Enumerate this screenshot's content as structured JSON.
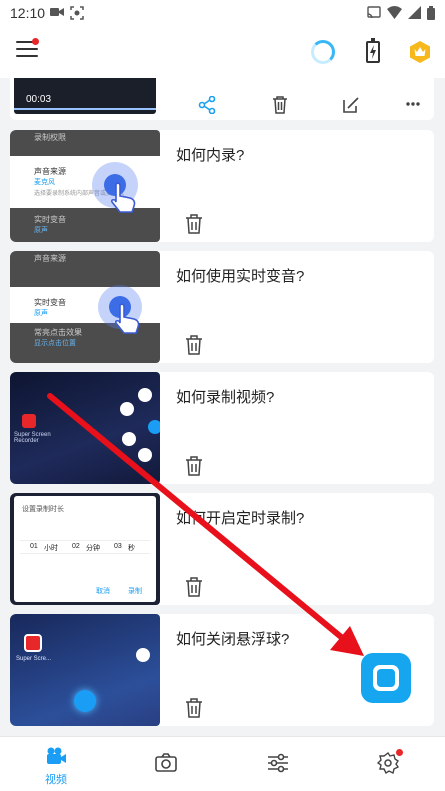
{
  "status_bar": {
    "time": "12:10"
  },
  "cards": [
    {
      "title": "如何内录?",
      "thumb": {
        "row1": "录制权限",
        "row2": "声音来源",
        "row2b": "麦克风",
        "row2c": "选择要录制系统内部声音或麦克风",
        "row3": "实时变音",
        "row3b": "原声"
      }
    },
    {
      "title": "如何使用实时变音?",
      "thumb": {
        "row1": "声音来源",
        "row2": "实时变音",
        "row2b": "原声",
        "row3": "常亮点击效果",
        "row3b": "显示点击位置"
      }
    },
    {
      "title": "如何录制视频?",
      "thumb": {
        "app_name": "Super Screen Recorder"
      }
    },
    {
      "title": "如何开启定时录制?",
      "thumb": {
        "dialog_title": "设置录制时长",
        "cols": [
          "小时",
          "分钟",
          "秒"
        ],
        "vals": [
          "01",
          "02",
          "03"
        ],
        "cancel": "取消",
        "confirm": "录制"
      }
    },
    {
      "title": "如何关闭悬浮球?",
      "thumb": {
        "app_name": "Super Scre..."
      }
    }
  ],
  "nav": [
    {
      "label": "视频",
      "icon": "video-camera-icon"
    },
    {
      "label": "",
      "icon": "camera-icon"
    },
    {
      "label": "",
      "icon": "sliders-icon"
    },
    {
      "label": "",
      "icon": "settings-icon"
    }
  ],
  "colors": {
    "accent": "#16a6f0",
    "red": "#e8272b"
  }
}
